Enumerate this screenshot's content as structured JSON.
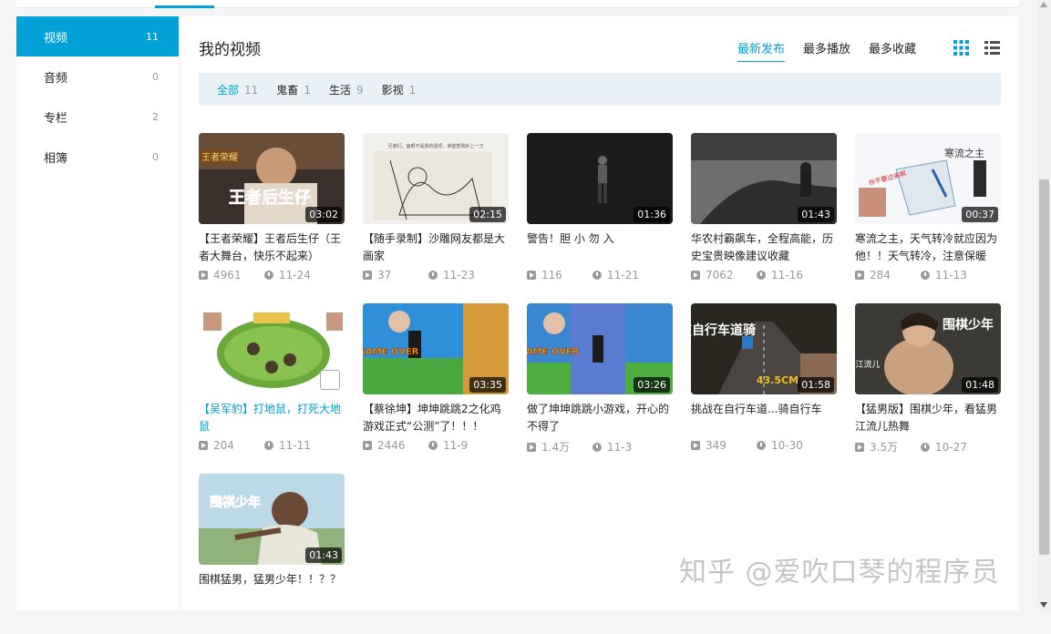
{
  "sidebar": {
    "items": [
      {
        "label": "视频",
        "count": "11"
      },
      {
        "label": "音频",
        "count": "0"
      },
      {
        "label": "专栏",
        "count": "2"
      },
      {
        "label": "相簿",
        "count": "0"
      }
    ]
  },
  "main": {
    "title": "我的视频",
    "sorts": [
      "最新发布",
      "最多播放",
      "最多收藏"
    ],
    "filters": [
      {
        "label": "全部",
        "count": "11"
      },
      {
        "label": "鬼畜",
        "count": "1"
      },
      {
        "label": "生活",
        "count": "9"
      },
      {
        "label": "影视",
        "count": "1"
      }
    ]
  },
  "videos": [
    {
      "title": "【王者荣耀】王者后生仔（王者大舞台，快乐不起来）",
      "duration": "03:02",
      "plays": "4961",
      "date": "11-24",
      "thumb_text": "王者后生仔",
      "thumb_badge": "王者荣耀"
    },
    {
      "title": "【随手录制】沙雕网友都是大画家",
      "duration": "02:15",
      "plays": "37",
      "date": "11-23",
      "thumb_text": "兄弟们，画眼不是我的强项，谁能帮我补上一刀"
    },
    {
      "title": "警告！胆 小 勿 入",
      "duration": "01:36",
      "plays": "116",
      "date": "11-21"
    },
    {
      "title": "华农村霸飙车，全程高能，历史宝贵映像建议收藏",
      "duration": "01:43",
      "plays": "7062",
      "date": "11-16"
    },
    {
      "title": "寒流之主，天气转冷就应因为他！！天气转冷，注意保暖",
      "duration": "00:37",
      "plays": "284",
      "date": "11-13",
      "thumb_text": "寒流之主",
      "thumb_badge": "你不要过来啊"
    },
    {
      "title": "【吴军豹】打地鼠，打死大地鼠",
      "duration": "",
      "plays": "204",
      "date": "11-11"
    },
    {
      "title": "【蔡徐坤】坤坤跳跳2之化鸡游戏正式“公测”了！！！",
      "duration": "03:35",
      "plays": "2446",
      "date": "11-9",
      "thumb_text": "GAME OVER"
    },
    {
      "title": "做了坤坤跳跳小游戏，开心的不得了",
      "duration": "03:26",
      "plays": "1.4万",
      "date": "11-3",
      "thumb_text": "GAME OVER"
    },
    {
      "title": "挑战在自行车道...骑自行车",
      "duration": "01:58",
      "plays": "349",
      "date": "10-30",
      "thumb_text": "挑战在自行车道骑",
      "thumb_badge": "43.5CM"
    },
    {
      "title": "【猛男版】围棋少年，看猛男江流儿热舞",
      "duration": "01:48",
      "plays": "3.5万",
      "date": "10-27",
      "thumb_text": "围棋少年",
      "thumb_badge": "江流儿"
    },
    {
      "title": "围棋猛男，猛男少年！！？？",
      "duration": "01:43",
      "plays": "",
      "date": "",
      "thumb_text": "围棋少年"
    }
  ],
  "watermark": "知乎 @爱吹口琴的程序员",
  "colors": {
    "accent": "#00a1d6",
    "filter_bg": "#e9f1f7"
  },
  "icons": {
    "grid_view": "grid-icon",
    "list_view": "list-icon",
    "play": "play-count-icon",
    "clock": "clock-icon",
    "watch_later": "watch-later-icon"
  }
}
